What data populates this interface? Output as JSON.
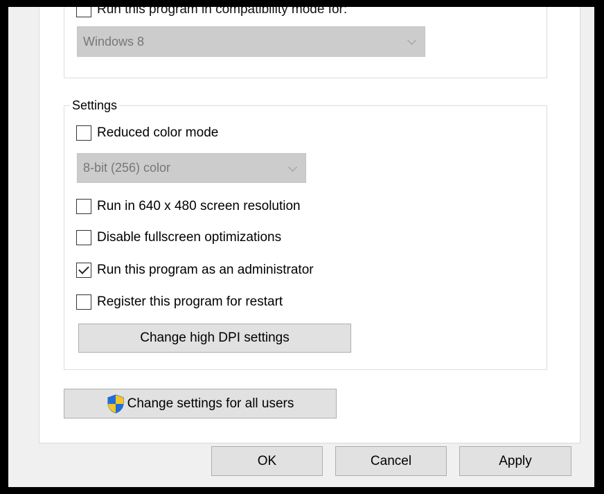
{
  "compat": {
    "checkbox_label": "Run this program in compatibility mode for:",
    "checked": false,
    "os_select_value": "Windows 8"
  },
  "settings": {
    "legend": "Settings",
    "reduced_color": {
      "label": "Reduced color mode",
      "checked": false
    },
    "color_select_value": "8-bit (256) color",
    "run_640": {
      "label": "Run in 640 x 480 screen resolution",
      "checked": false
    },
    "disable_fullscreen": {
      "label": "Disable fullscreen optimizations",
      "checked": false
    },
    "run_admin": {
      "label": "Run this program as an administrator",
      "checked": true
    },
    "register_restart": {
      "label": "Register this program for restart",
      "checked": false
    },
    "high_dpi_button": "Change high DPI settings"
  },
  "all_users_button": {
    "label": "Change settings for all users",
    "icon": "uac-shield-icon"
  },
  "footer": {
    "ok": "OK",
    "cancel": "Cancel",
    "apply": "Apply"
  },
  "colors": {
    "dialog_bg": "#f0f0f0",
    "panel_bg": "#ffffff",
    "button_bg": "#e1e1e1",
    "disabled_select_bg": "#cccccc",
    "shield_blue": "#1e6fd9",
    "shield_yellow": "#f7c325"
  }
}
